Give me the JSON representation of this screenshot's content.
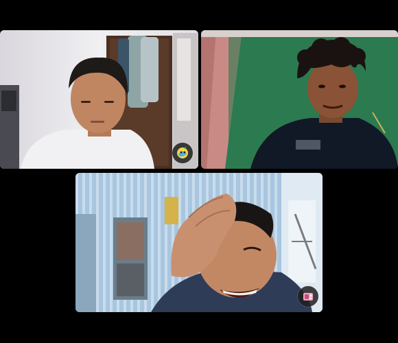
{
  "call": {
    "participants": [
      {
        "id": "participant-1",
        "reaction_icon": "sticker-emoji-icon"
      },
      {
        "id": "participant-2"
      },
      {
        "id": "participant-3",
        "reaction_icon": "camera-effects-icon"
      }
    ]
  },
  "colors": {
    "background": "#000000",
    "tile1_wall": "#e9e8ea",
    "tile2_green": "#2f7a52",
    "tile3_wall": "#a9c6de",
    "badge_bg": "#1e1e1e"
  }
}
